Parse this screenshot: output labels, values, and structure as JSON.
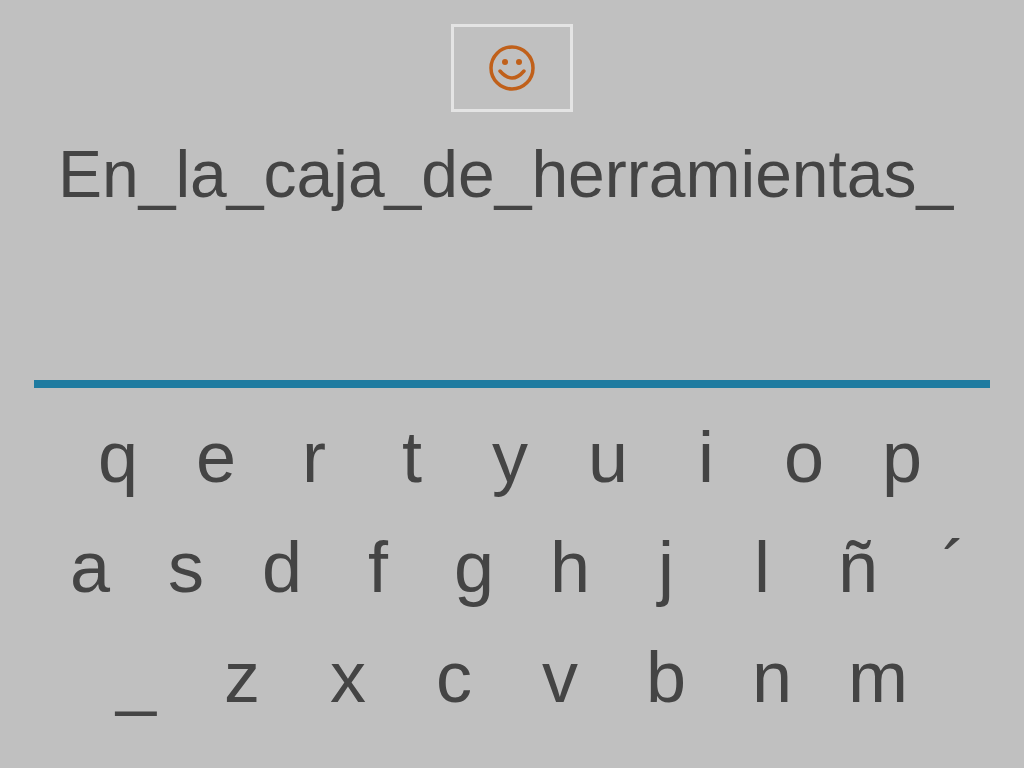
{
  "sentence": "En_la_caja_de_herramientas_",
  "keyboard": {
    "rows": [
      [
        "q",
        "e",
        "r",
        "t",
        "y",
        "u",
        "i",
        "o",
        "p"
      ],
      [
        "a",
        "s",
        "d",
        "f",
        "g",
        "h",
        "j",
        "l",
        "ñ",
        "´"
      ],
      [
        "_",
        "z",
        "x",
        "c",
        "v",
        "b",
        "n",
        "m"
      ]
    ]
  }
}
